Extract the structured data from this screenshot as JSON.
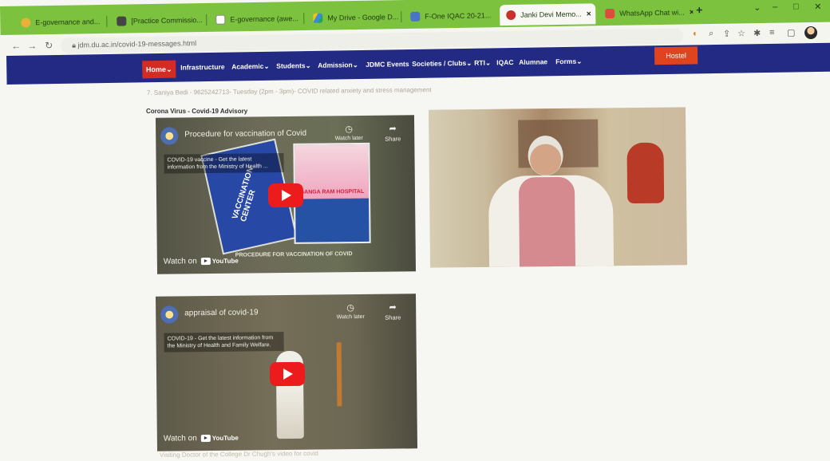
{
  "browser": {
    "tabs": [
      {
        "label": "E-governance and...",
        "active": false
      },
      {
        "label": "[Practice Commissio...",
        "active": false
      },
      {
        "label": "E-governance (awe...",
        "active": false
      },
      {
        "label": "My Drive - Google D...",
        "active": false
      },
      {
        "label": "F-One IQAC 20-21...",
        "active": false
      },
      {
        "label": "Janki Devi Memo...",
        "active": true
      },
      {
        "label": "WhatsApp Chat wi...",
        "active": false
      }
    ],
    "url": "jdm.du.ac.in/covid-19-messages.html",
    "colors": {
      "tabstrip": "#7cc23e",
      "nav": "#222a84",
      "home": "#d42b23"
    }
  },
  "nav": {
    "items": [
      "Home",
      "Infrastructure",
      "Academic",
      "Students",
      "Admission",
      "JDMC Events",
      "Societies / Clubs",
      "RTI",
      "IQAC",
      "Alumnae",
      "Forms"
    ],
    "hostel": "Hostel"
  },
  "content": {
    "faded_line": "7. Saniya Bedi - 9625242713- Tuesday (2pm - 3pm)- COVID related anxiety and stress management",
    "section_title": "Corona Virus - Covid-19 Advisory",
    "videos": [
      {
        "title": "Procedure for vaccination of Covid",
        "description": "COVID-19 vaccine - Get the latest information from the Ministry of Health ...",
        "watch_later": "Watch later",
        "share": "Share",
        "watch_on": "Watch on",
        "youtube": "YouTube",
        "poster_left": "VACCINATION CENTER",
        "poster_right": "GANGA RAM HOSPITAL",
        "banner": "PROCEDURE FOR VACCINATION OF COVID"
      },
      {
        "title": ""
      },
      {
        "title": "appraisal of covid-19",
        "description": "COVID-19 - Get the latest information from the Ministry of Health and Family Welfare.",
        "watch_later": "Watch later",
        "share": "Share",
        "watch_on": "Watch on",
        "youtube": "YouTube"
      }
    ],
    "caption": "Visiting Doctor of the College Dr Chugh's video for covid"
  }
}
